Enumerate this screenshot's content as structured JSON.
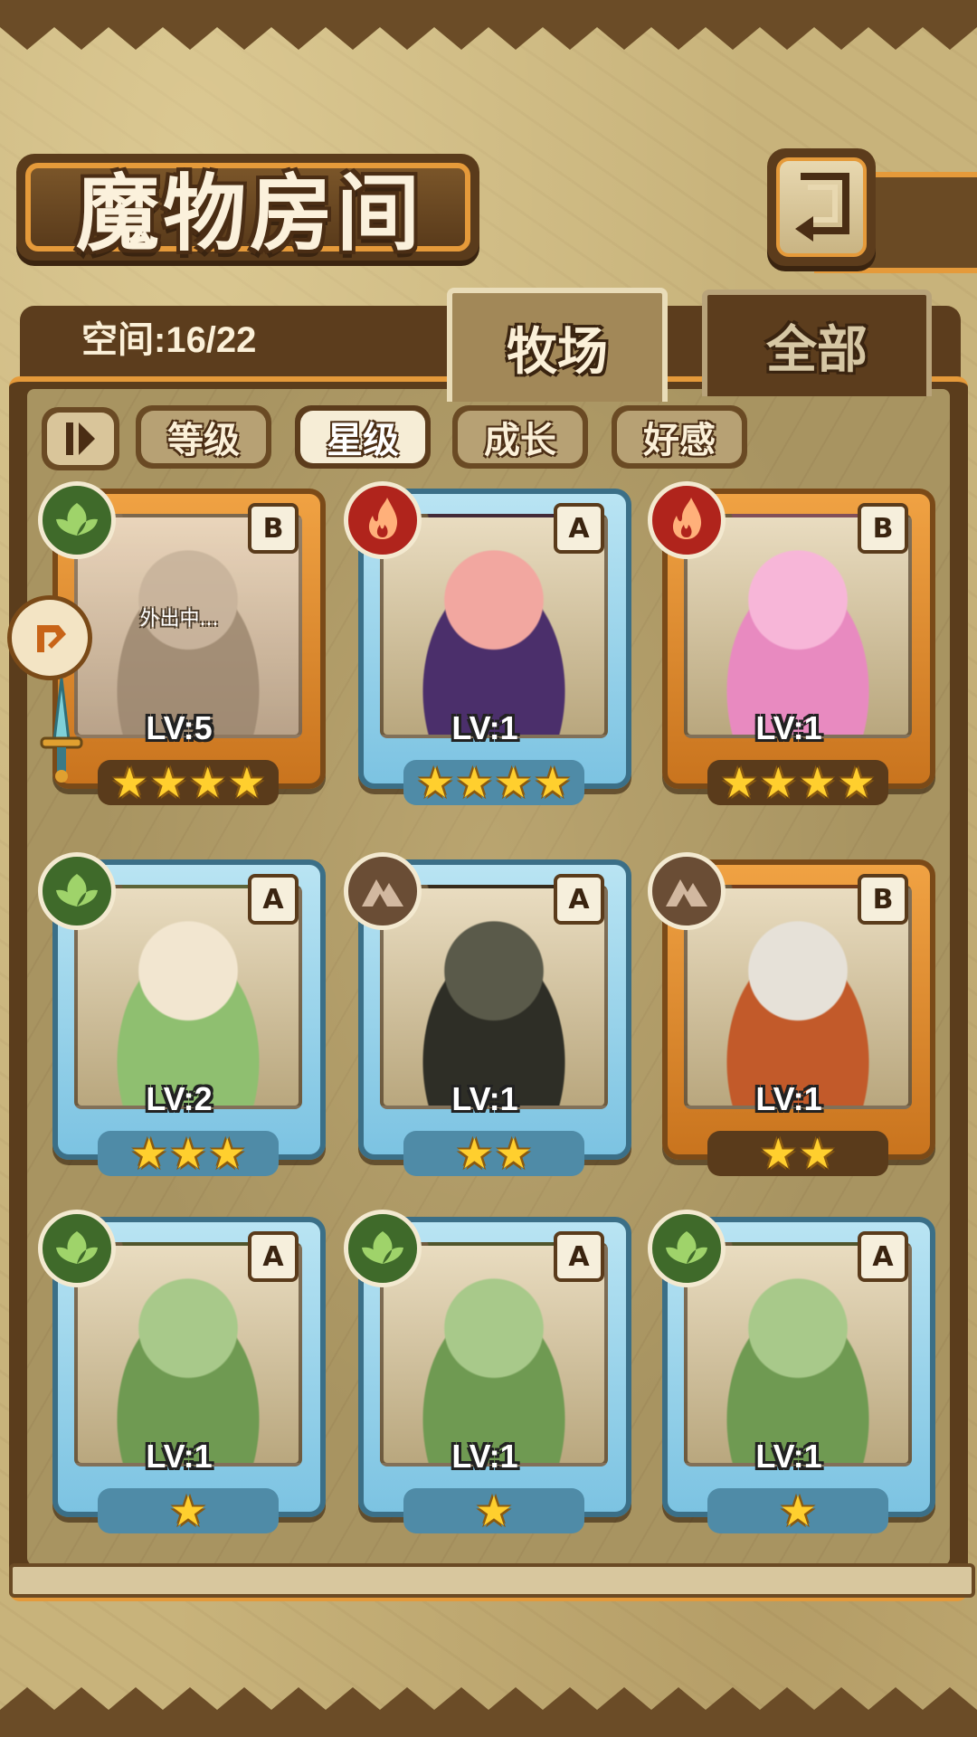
{
  "header": {
    "title": "魔物房间"
  },
  "space": {
    "label": "空间:16/22"
  },
  "tabs": [
    {
      "label": "牧场",
      "active": true
    },
    {
      "label": "全部",
      "active": false
    }
  ],
  "filters": [
    {
      "label": "等级",
      "active": false
    },
    {
      "label": "星级",
      "active": true
    },
    {
      "label": "成长",
      "active": false
    },
    {
      "label": "好感",
      "active": false
    }
  ],
  "monsters": [
    {
      "level": "LV:5",
      "rank": "B",
      "element": "grass",
      "stars": 4,
      "frame": "gold",
      "status": "外出中..."
    },
    {
      "level": "LV:1",
      "rank": "A",
      "element": "fire",
      "stars": 4,
      "frame": "blue"
    },
    {
      "level": "LV:1",
      "rank": "B",
      "element": "fire",
      "stars": 4,
      "frame": "gold"
    },
    {
      "level": "LV:2",
      "rank": "A",
      "element": "grass",
      "stars": 3,
      "frame": "blue"
    },
    {
      "level": "LV:1",
      "rank": "A",
      "element": "earth",
      "stars": 2,
      "frame": "blue"
    },
    {
      "level": "LV:1",
      "rank": "B",
      "element": "earth",
      "stars": 2,
      "frame": "gold"
    },
    {
      "level": "LV:1",
      "rank": "A",
      "element": "grass",
      "stars": 1,
      "frame": "blue"
    },
    {
      "level": "LV:1",
      "rank": "A",
      "element": "grass",
      "stars": 1,
      "frame": "blue"
    },
    {
      "level": "LV:1",
      "rank": "A",
      "element": "grass",
      "stars": 1,
      "frame": "blue"
    }
  ],
  "colors": {
    "frame_gold": "#f0a243",
    "frame_blue": "#b9e4f3",
    "panel": "#5b3d1c",
    "accent": "#e59a3a"
  },
  "icons": {
    "back": "back-arrow-icon",
    "sort": "sort-toggle-icon",
    "outing": "outing-icon",
    "weapon": "sword-icon"
  }
}
